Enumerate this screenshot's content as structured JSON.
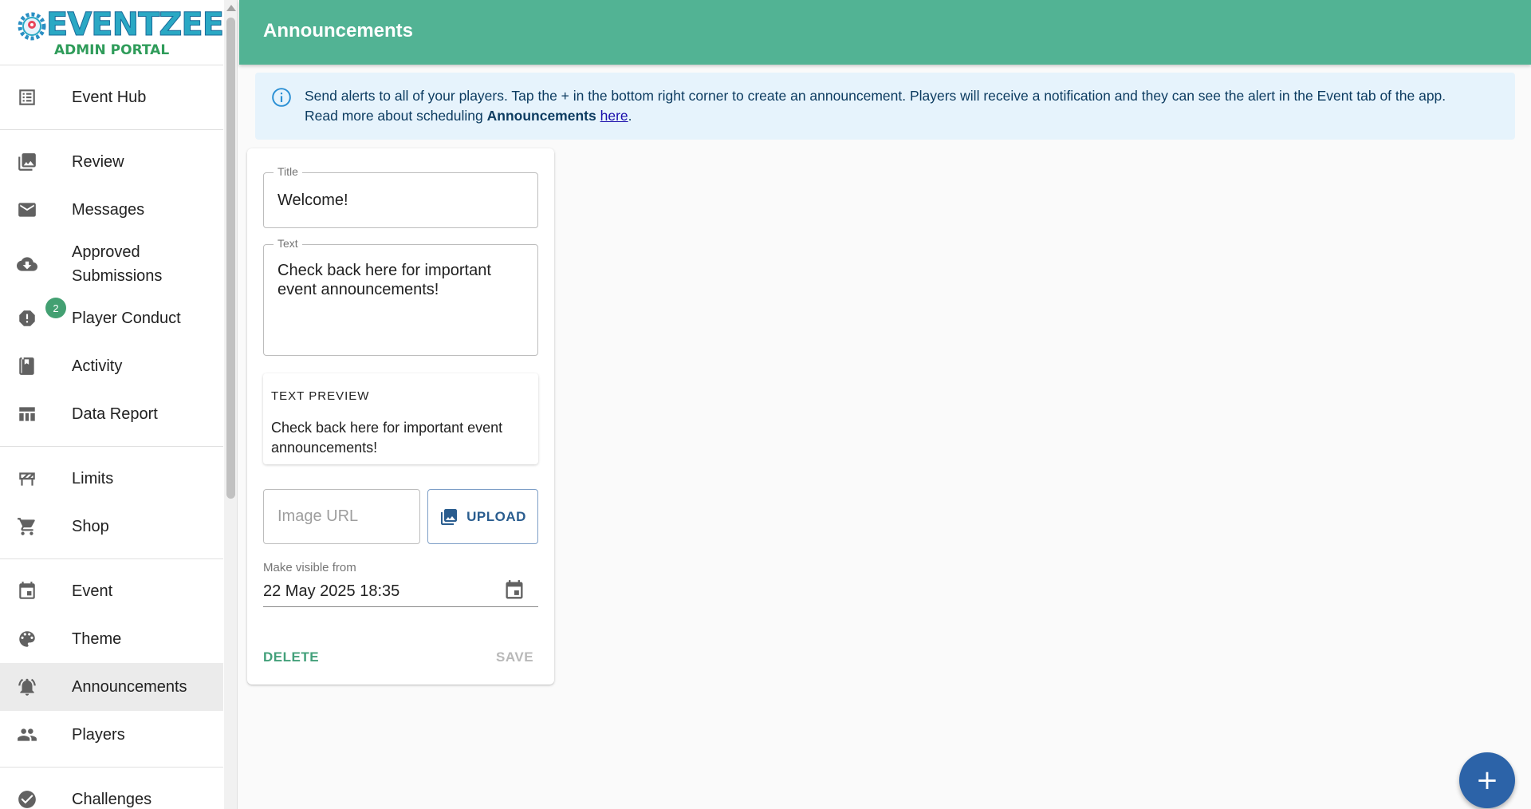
{
  "logo": {
    "title": "EVENTZEE",
    "subtitle": "ADMIN PORTAL"
  },
  "sidebar": {
    "items": [
      {
        "label": "Event Hub",
        "icon": "list-icon"
      },
      {
        "label": "Review",
        "icon": "image-icon"
      },
      {
        "label": "Messages",
        "icon": "mail-icon"
      },
      {
        "label": "Approved Submissions",
        "icon": "cloud-download-icon"
      },
      {
        "label": "Player Conduct",
        "icon": "alert-icon",
        "badge": "2"
      },
      {
        "label": "Activity",
        "icon": "notebook-icon"
      },
      {
        "label": "Data Report",
        "icon": "table-icon"
      },
      {
        "label": "Limits",
        "icon": "barrier-icon"
      },
      {
        "label": "Shop",
        "icon": "cart-icon"
      },
      {
        "label": "Event",
        "icon": "calendar-icon"
      },
      {
        "label": "Theme",
        "icon": "palette-icon"
      },
      {
        "label": "Announcements",
        "icon": "bell-icon",
        "active": true
      },
      {
        "label": "Players",
        "icon": "people-icon"
      },
      {
        "label": "Challenges",
        "icon": "check-icon"
      }
    ]
  },
  "header": {
    "title": "Announcements"
  },
  "info": {
    "text": "Send alerts to all of your players. Tap the + in the bottom right corner to create an announcement. Players will receive a notification and they can see the alert in the Event tab of the app.",
    "line2_prefix": "Read more about scheduling ",
    "line2_bold": "Announcements",
    "line2_link": "here",
    "line2_suffix": "."
  },
  "form": {
    "title_label": "Title",
    "title_value": "Welcome!",
    "text_label": "Text",
    "text_value": "Check back here for important event announcements!",
    "preview_label": "TEXT PREVIEW",
    "preview_text": "Check back here for important event announcements!",
    "image_placeholder": "Image URL",
    "upload_label": "UPLOAD",
    "visible_label": "Make visible from",
    "visible_value": "22 May 2025 18:35",
    "delete_label": "DELETE",
    "save_label": "SAVE"
  },
  "fab": {
    "label": "+"
  },
  "colors": {
    "header": "#52b394",
    "accent": "#43a07a",
    "primary": "#2c63a8",
    "info_bg": "#e6f3fc"
  }
}
